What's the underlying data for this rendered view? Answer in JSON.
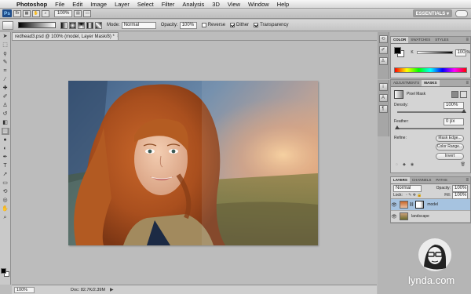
{
  "menubar": {
    "apple_glyph": "",
    "items": [
      "Photoshop",
      "File",
      "Edit",
      "Image",
      "Layer",
      "Select",
      "Filter",
      "Analysis",
      "3D",
      "View",
      "Window",
      "Help"
    ]
  },
  "appbar": {
    "ps_badge": "Ps",
    "zoom": "100%",
    "workspace": "ESSENTIALS ▾"
  },
  "options": {
    "mode_label": "Mode:",
    "mode_value": "Normal",
    "opacity_label": "Opacity:",
    "opacity_value": "100%",
    "reverse_label": "Reverse",
    "dither_label": "Dither",
    "transparency_label": "Transparency",
    "reverse_checked": false,
    "dither_checked": true,
    "transparency_checked": true
  },
  "document": {
    "tab_title": "redhead3.psd @ 100% (model, Layer Mask/8) *",
    "close_glyph": "×"
  },
  "status": {
    "zoom": "100%",
    "doc_size": "Doc: 82.7K/2.39M",
    "arrow": "▶"
  },
  "color_panel": {
    "tabs": [
      "COLOR",
      "SWATCHES",
      "STYLES"
    ],
    "channel_label": "K",
    "value": "100",
    "unit": "%"
  },
  "masks_panel": {
    "tabs": [
      "ADJUSTMENTS",
      "MASKS"
    ],
    "mask_type": "Pixel Mask",
    "density_label": "Density:",
    "density_value": "100%",
    "density_level": 1.0,
    "feather_label": "Feather:",
    "feather_value": "0 px",
    "feather_level": 0.0,
    "refine_label": "Refine:",
    "buttons": [
      "Mask Edge...",
      "Color Range...",
      "Invert"
    ]
  },
  "layers_panel": {
    "tabs": [
      "LAYERS",
      "CHANNELS",
      "PATHS"
    ],
    "blend_mode": "Normal",
    "opacity_label": "Opacity:",
    "opacity_value": "100%",
    "lock_label": "Lock:",
    "fill_label": "Fill:",
    "fill_value": "100%",
    "layers": [
      {
        "name": "model",
        "selected": true,
        "has_mask": true
      },
      {
        "name": "landscape",
        "selected": false,
        "has_mask": false
      }
    ]
  },
  "watermark": {
    "brand": "lynda.com"
  },
  "colors": {
    "selected_layer": "#a6c3e0",
    "ps_badge": "#1e4c8a"
  }
}
